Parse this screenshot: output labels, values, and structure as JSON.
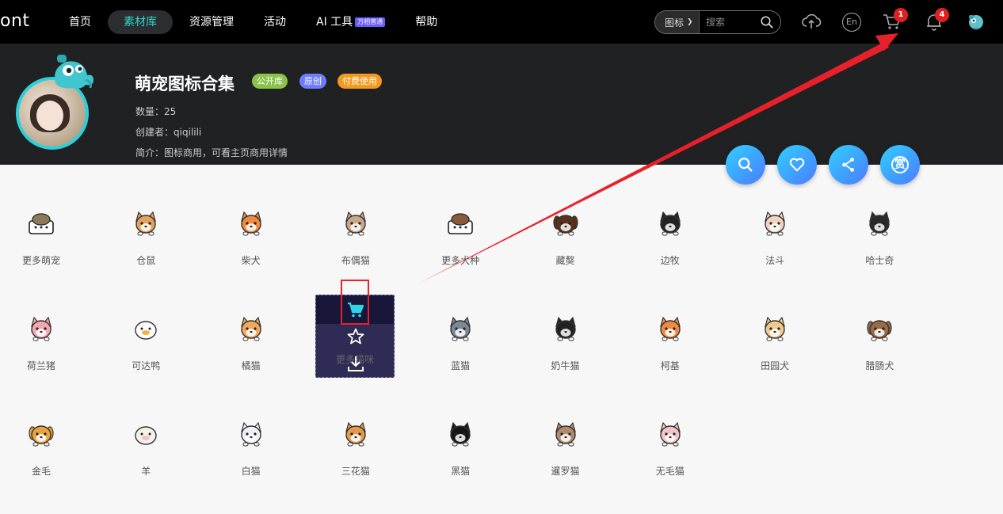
{
  "nav": {
    "logo": "ont",
    "items": [
      "首页",
      "素材库",
      "资源管理",
      "活动",
      "AI 工具",
      "帮助"
    ],
    "active_index": 1,
    "ai_badge": "万相普通"
  },
  "search": {
    "type": "图标",
    "placeholder": "搜索"
  },
  "top_icons": {
    "cart_count": "1",
    "bell_count": "4",
    "lang": "En"
  },
  "collection": {
    "title": "萌宠图标合集",
    "tags": [
      {
        "label": "公开库",
        "color": "#8bc34a"
      },
      {
        "label": "原创",
        "color": "#6f7cff"
      },
      {
        "label": "付费使用",
        "color": "#f39a1e"
      }
    ],
    "count": "数量：25",
    "creator": "创建者：qiqilili",
    "intro": "简介：图标商用，可看主页商用详情"
  },
  "actions": [
    "search-icon",
    "heart-icon",
    "share-icon",
    "reward-icon"
  ],
  "reward_char": "赏",
  "icons": [
    {
      "label": "更多萌宠",
      "kind": "turtle",
      "color": "#8c7a5a"
    },
    {
      "label": "仓鼠",
      "kind": "hamster",
      "color": "#e3a25c"
    },
    {
      "label": "柴犬",
      "kind": "shiba",
      "color": "#f08a3e"
    },
    {
      "label": "布偶猫",
      "kind": "ragdoll",
      "color": "#c9a78b"
    },
    {
      "label": "更多犬种",
      "kind": "dogbox",
      "color": "#8a5a3c"
    },
    {
      "label": "藏獒",
      "kind": "mastiff",
      "color": "#5a3218"
    },
    {
      "label": "边牧",
      "kind": "collie",
      "color": "#222222"
    },
    {
      "label": "法斗",
      "kind": "bulldog",
      "color": "#f0d3c0"
    },
    {
      "label": "哈士奇",
      "kind": "husky",
      "color": "#2a2a2a"
    },
    {
      "label": "荷兰猪",
      "kind": "guinea",
      "color": "#f3a7b0"
    },
    {
      "label": "可达鸭",
      "kind": "duck",
      "color": "#ffffff"
    },
    {
      "label": "橘猫",
      "kind": "orangecat",
      "color": "#f2a95c"
    },
    {
      "label": "更多猫咪",
      "kind": "cat",
      "color": "#e9b17a"
    },
    {
      "label": "蓝猫",
      "kind": "bluecat",
      "color": "#7d8894"
    },
    {
      "label": "奶牛猫",
      "kind": "cowcat",
      "color": "#222222"
    },
    {
      "label": "柯基",
      "kind": "corgi",
      "color": "#f08a3e"
    },
    {
      "label": "田园犬",
      "kind": "countrydog",
      "color": "#f2c98e"
    },
    {
      "label": "腊肠犬",
      "kind": "dachshund",
      "color": "#9a6a46"
    },
    {
      "label": "金毛",
      "kind": "golden",
      "color": "#e9a441"
    },
    {
      "label": "羊",
      "kind": "sheep",
      "color": "#f5f0ea"
    },
    {
      "label": "白猫",
      "kind": "whitecat",
      "color": "#eef2f8"
    },
    {
      "label": "三花猫",
      "kind": "calico",
      "color": "#e49a4a"
    },
    {
      "label": "黑猫",
      "kind": "blackcat",
      "color": "#151515"
    },
    {
      "label": "暹罗猫",
      "kind": "siamese",
      "color": "#b08a6c"
    },
    {
      "label": "无毛猫",
      "kind": "sphynx",
      "color": "#f4c4c4"
    }
  ],
  "overlay": {
    "index": 12,
    "buttons": [
      "cart-icon",
      "star-icon",
      "download-icon"
    ],
    "accent": "#2cd6e8"
  }
}
